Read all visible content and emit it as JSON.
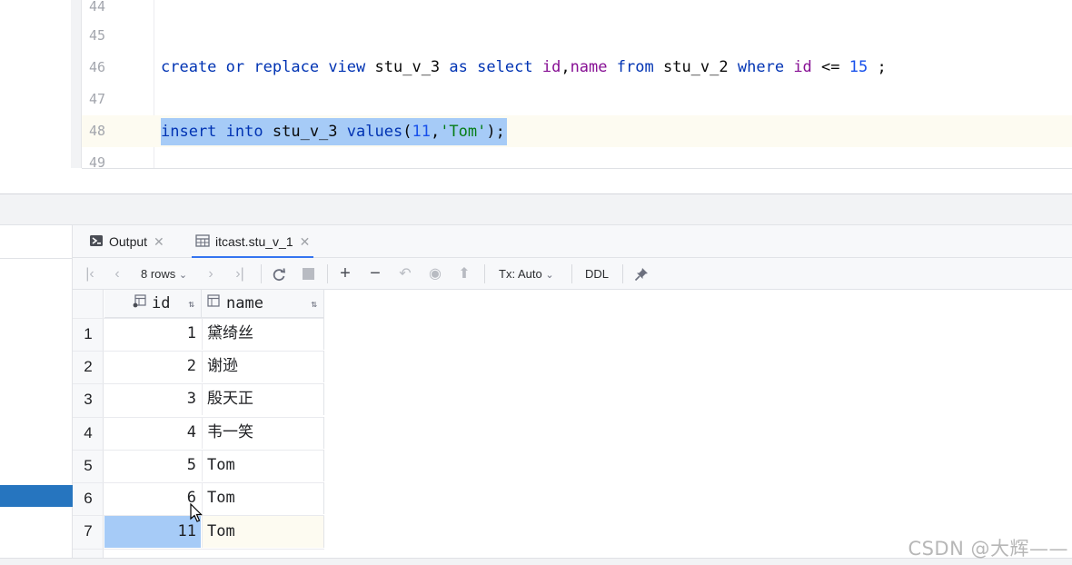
{
  "editor": {
    "lines": [
      {
        "num": "44",
        "code": ""
      },
      {
        "num": "45",
        "code": ""
      },
      {
        "num": "46",
        "code": "create or replace view stu_v_3 as select id,name from stu_v_2 where id <= 15 ;"
      },
      {
        "num": "47",
        "code": ""
      },
      {
        "num": "48",
        "code": "insert into stu_v_3 values(11,'Tom');"
      },
      {
        "num": "49",
        "code": ""
      }
    ],
    "tokens_46": {
      "t1": "create",
      "t2": "or",
      "t3": "replace",
      "t4": "view",
      "t5": "stu_v_3",
      "t6": "as",
      "t7": "select",
      "t8": "id",
      "t9": ",",
      "t10": "name",
      "t11": "from",
      "t12": "stu_v_2",
      "t13": "where",
      "t14": "id",
      "t15": "<=",
      "t16": "15",
      "t17": ";"
    },
    "tokens_48": {
      "t1": "insert",
      "t2": "into",
      "t3": "stu_v_3",
      "t4": "values",
      "t5": "(",
      "t6": "11",
      "t7": ",",
      "t8": "'Tom'",
      "t9": ");"
    }
  },
  "tabs": [
    {
      "label": "Output",
      "icon": "console-icon",
      "active": false
    },
    {
      "label": "itcast.stu_v_1",
      "icon": "table-icon",
      "active": true
    }
  ],
  "toolbar": {
    "rows_label": "8 rows",
    "tx_label": "Tx: Auto",
    "ddl_label": "DDL"
  },
  "grid": {
    "columns": [
      "id",
      "name"
    ],
    "rows": [
      {
        "rownum": "1",
        "id": "1",
        "name": "黛绮丝"
      },
      {
        "rownum": "2",
        "id": "2",
        "name": "谢逊"
      },
      {
        "rownum": "3",
        "id": "3",
        "name": "殷天正"
      },
      {
        "rownum": "4",
        "id": "4",
        "name": "韦一笑"
      },
      {
        "rownum": "5",
        "id": "5",
        "name": "Tom"
      },
      {
        "rownum": "6",
        "id": "6",
        "name": "Tom"
      },
      {
        "rownum": "7",
        "id": "11",
        "name": "Tom"
      }
    ],
    "selected_row": "7"
  },
  "watermark": "CSDN @大辉——",
  "colors": {
    "selection": "#a6cbf7",
    "keyword": "#0033b3",
    "column": "#871094",
    "number": "#1750eb",
    "string": "#067d17",
    "accent": "#3574f0"
  }
}
